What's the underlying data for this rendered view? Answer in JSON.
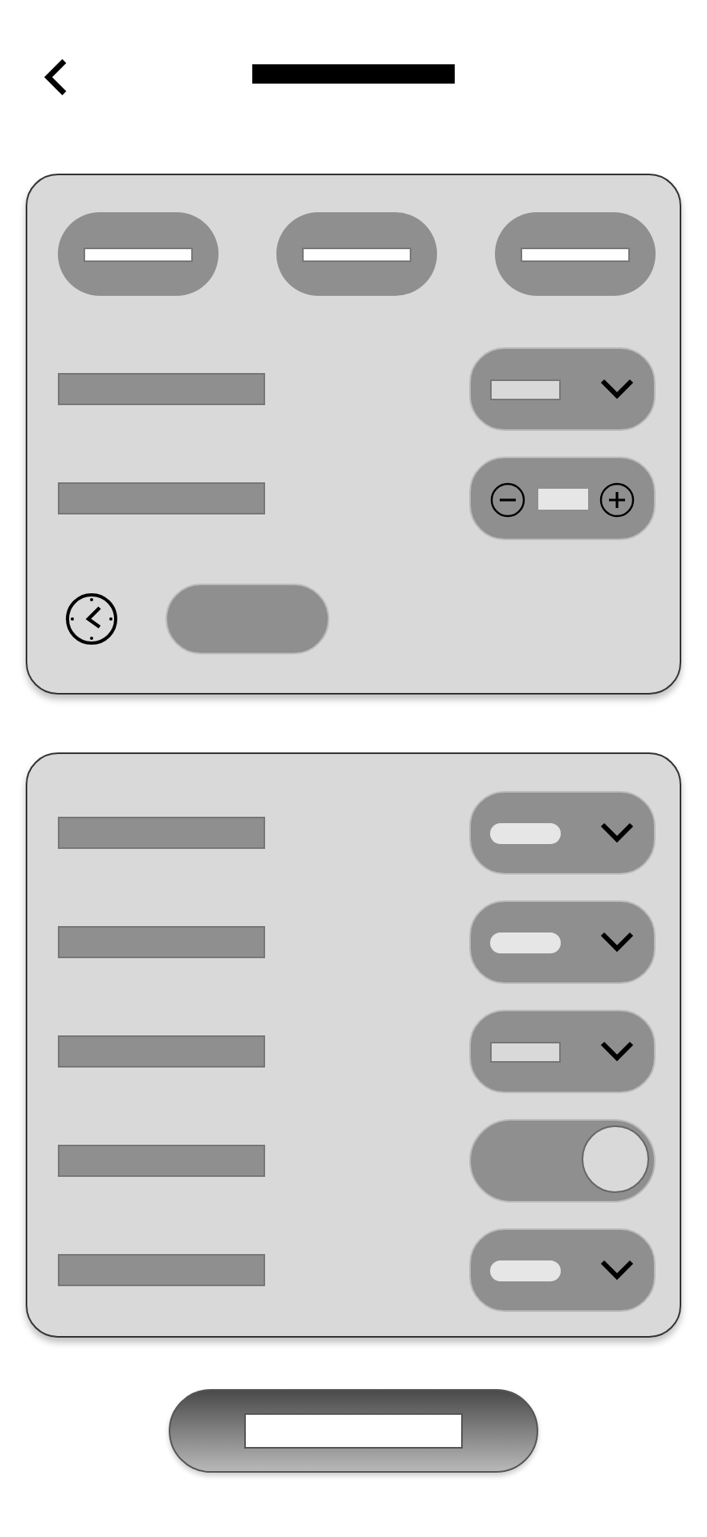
{
  "header": {
    "back": {
      "kind": "chevron"
    },
    "title": {
      "kind": "placeholder"
    }
  },
  "top_card": {
    "segments": [
      {
        "kind": "pill"
      },
      {
        "kind": "pill"
      },
      {
        "kind": "pill"
      }
    ],
    "rows": [
      {
        "kind": "dropdown",
        "value": {
          "kind": "box"
        }
      },
      {
        "kind": "stepper"
      }
    ],
    "time": {
      "kind": "clock"
    }
  },
  "settings_card": {
    "rows": [
      {
        "kind": "dropdown",
        "value": {
          "kind": "pill"
        }
      },
      {
        "kind": "dropdown",
        "value": {
          "kind": "pill"
        }
      },
      {
        "kind": "dropdown",
        "value": {
          "kind": "box"
        }
      },
      {
        "kind": "toggle",
        "on": true
      },
      {
        "kind": "dropdown",
        "value": {
          "kind": "pill"
        }
      }
    ]
  },
  "primary_button": {
    "kind": "placeholder"
  }
}
